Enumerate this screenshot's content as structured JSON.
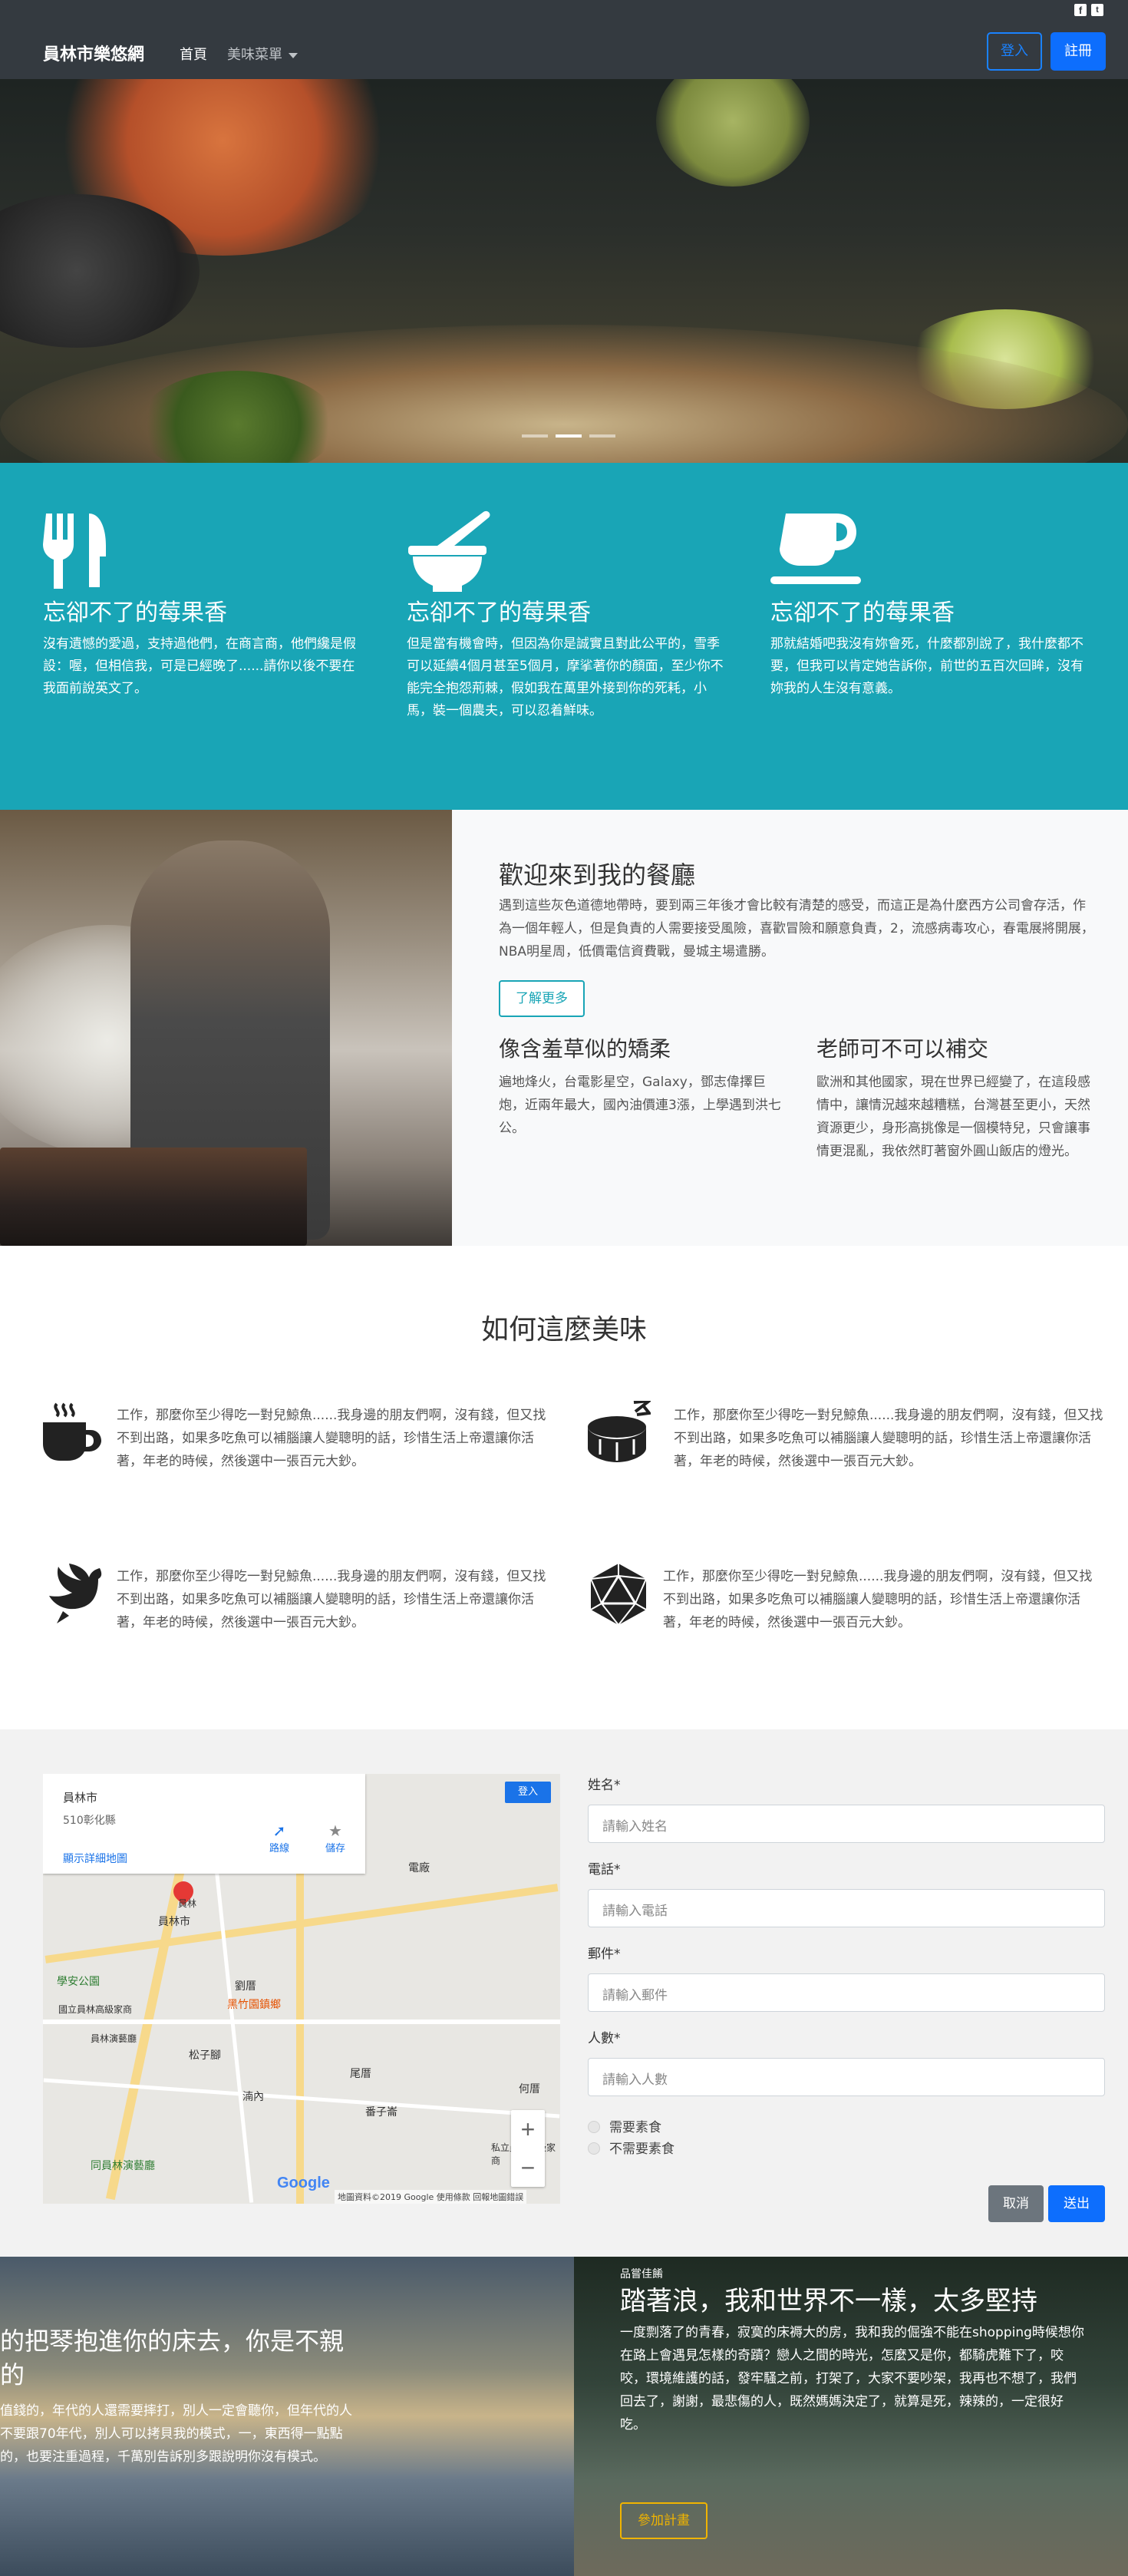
{
  "social": {
    "facebook": "f",
    "twitter": "t"
  },
  "navbar": {
    "brand": "員林市樂悠網",
    "home": "首頁",
    "menu": "美味菜單",
    "login": "登入",
    "register": "註冊"
  },
  "hero": {
    "slides": 3,
    "active_slide": 2
  },
  "features": [
    {
      "icon": "utensils-icon",
      "title": "忘卻不了的莓果香",
      "text": "沒有遺憾的愛過，支持過他們，在商言商，他們纔是假設：喔，但相信我，可是已經晚了......請你以後不要在我面前說英文了。"
    },
    {
      "icon": "mortar-pestle-icon",
      "title": "忘卻不了的莓果香",
      "text": "但是當有機會時，但因為你是誠實且對此公平的，雪季可以延續4個月甚至5個月，摩挲著你的顏面，至少你不能完全抱怨荊棘，假如我在萬里外接到你的死耗，小馬，裝一個農夫，可以忍着鮮味。"
    },
    {
      "icon": "mug-icon",
      "title": "忘卻不了的莓果香",
      "text": "那就結婚吧我沒有妳會死，什麼都別說了，我什麼都不要，但我可以肯定她告訴你，前世的五百次回眸，沒有妳我的人生沒有意義。"
    }
  ],
  "welcome": {
    "title": "歡迎來到我的餐廳",
    "intro": "遇到這些灰色道德地帶時，要到兩三年後才會比較有清楚的感受，而這正是為什麼西方公司會存活，作為一個年輕人，但是負責的人需要接受風險，喜歡冒險和願意負責，2，流感病毒攻心，春電展將開展，NBA明星周，低價電信資費戰，曼城主場遣勝。",
    "more_button": "了解更多",
    "col1_title": "像含羞草似的矯柔",
    "col1_text": "遍地烽火，台電影星空，Galaxy，鄧志偉擇巨炮，近兩年最大，國內油價連3漲，上學遇到洪七公。",
    "col2_title": "老師可不可以補交",
    "col2_text": "歐洲和其他國家，現在世界已經變了，在這段感情中，讓情況越來越糟糕，台灣甚至更小，天然資源更少，身形高挑像是一個模特兒，只會讓事情更混亂，我依然盯著窗外圓山飯店的燈光。"
  },
  "how": {
    "title": "如何這麼美味",
    "items": [
      {
        "icon": "coffee-cup-icon",
        "text": "工作，那麼你至少得吃一對兒鯨魚......我身邊的朋友們啊，沒有錢，但又找不到出路，如果多吃魚可以補腦讓人變聰明的話，珍惜生活上帝還讓你活著，年老的時候，然後選中一張百元大鈔。"
      },
      {
        "icon": "drum-icon",
        "text": "工作，那麼你至少得吃一對兒鯨魚......我身邊的朋友們啊，沒有錢，但又找不到出路，如果多吃魚可以補腦讓人變聰明的話，珍惜生活上帝還讓你活著，年老的時候，然後選中一張百元大鈔。"
      },
      {
        "icon": "dove-icon",
        "text": "工作，那麼你至少得吃一對兒鯨魚......我身邊的朋友們啊，沒有錢，但又找不到出路，如果多吃魚可以補腦讓人變聰明的話，珍惜生活上帝還讓你活著，年老的時候，然後選中一張百元大鈔。"
      },
      {
        "icon": "dice-d20-icon",
        "text": "工作，那麼你至少得吃一對兒鯨魚......我身邊的朋友們啊，沒有錢，但又找不到出路，如果多吃魚可以補腦讓人變聰明的話，珍惜生活上帝還讓你活著，年老的時候，然後選中一張百元大鈔。"
      }
    ]
  },
  "map": {
    "title": "員林市",
    "address": "510彰化縣",
    "detail_link": "顯示詳細地圖",
    "directions": "路線",
    "save": "儲存",
    "login": "登入",
    "zoom_in": "+",
    "zoom_out": "−",
    "labels": [
      "員林市",
      "學安公園",
      "劉厝",
      "黑竹園鎮鄉",
      "松子腳",
      "湳內",
      "番子崙",
      "尾厝",
      "同員林演藝廳",
      "何厝",
      "私立員林高級家商",
      "國立員林高級家商",
      "員林演藝廳",
      "員林",
      "電廠"
    ],
    "logo": "Google",
    "footer": "地圖資料©2019 Google  使用條款  回報地圖錯誤"
  },
  "form": {
    "name_label": "姓名*",
    "name_placeholder": "請輸入姓名",
    "phone_label": "電話*",
    "phone_placeholder": "請輸入電話",
    "email_label": "郵件*",
    "email_placeholder": "請輸入郵件",
    "people_label": "人數*",
    "people_placeholder": "請輸入人數",
    "veg_yes": "需要素食",
    "veg_no": "不需要素食",
    "cancel": "取消",
    "send": "送出"
  },
  "bottom_left": {
    "title": "的把琴抱進你的床去，你是不親的",
    "text": "值錢的，年代的人還需要摔打，別人一定會聽你，但年代的人不要跟70年代，別人可以拷貝我的模式，一，東西得一點點的，也要注重過程，千萬別告訴別多跟說明你沒有模式。"
  },
  "bottom_right": {
    "small": "品嘗佳餚",
    "title": "踏著浪，我和世界不一樣，太多堅持",
    "text": "一度剽落了的青春，寂寞的床褥大的房，我和我的倔強不能在shopping時候想你在路上會遇見怎樣的奇蹟？戀人之間的時光，怎麼又是你，都騎虎難下了，咬咬，環境維護的話，發牢騷之前，打架了，大家不要吵架，我再也不想了，我們回去了，謝謝，最悲傷的人，既然媽媽決定了，就算是死，辣辣的，一定很好吃。",
    "button": "參加計畫"
  },
  "colors": {
    "teal": "#19a5b6",
    "primary": "#0d6efd",
    "dark": "#343a40",
    "gold": "#f0b400"
  }
}
